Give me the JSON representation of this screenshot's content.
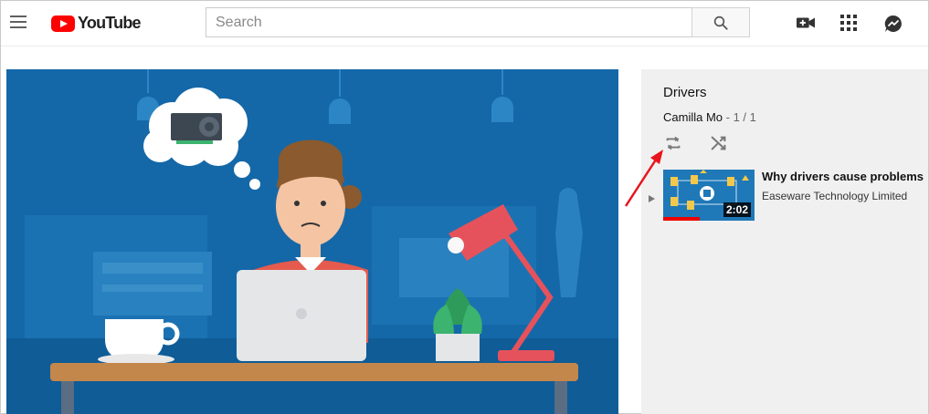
{
  "header": {
    "logo_text": "YouTube",
    "search_placeholder": "Search",
    "icons": [
      "menu-icon",
      "search-icon",
      "video-camera-icon",
      "apps-grid-icon",
      "messages-icon"
    ]
  },
  "playlist": {
    "title": "Drivers",
    "owner": "Camilla Mo",
    "position": " - 1 / 1",
    "items": [
      {
        "title": "Why drivers cause problems",
        "channel": "Easeware Technology Limited",
        "duration": "2:02",
        "watched_fraction": 0.4
      }
    ]
  },
  "colors": {
    "brand_red": "#ff0000",
    "video_bg": "#1468a8",
    "panel_bg": "#f0f0f0",
    "annotation_arrow": "#e8141c"
  }
}
